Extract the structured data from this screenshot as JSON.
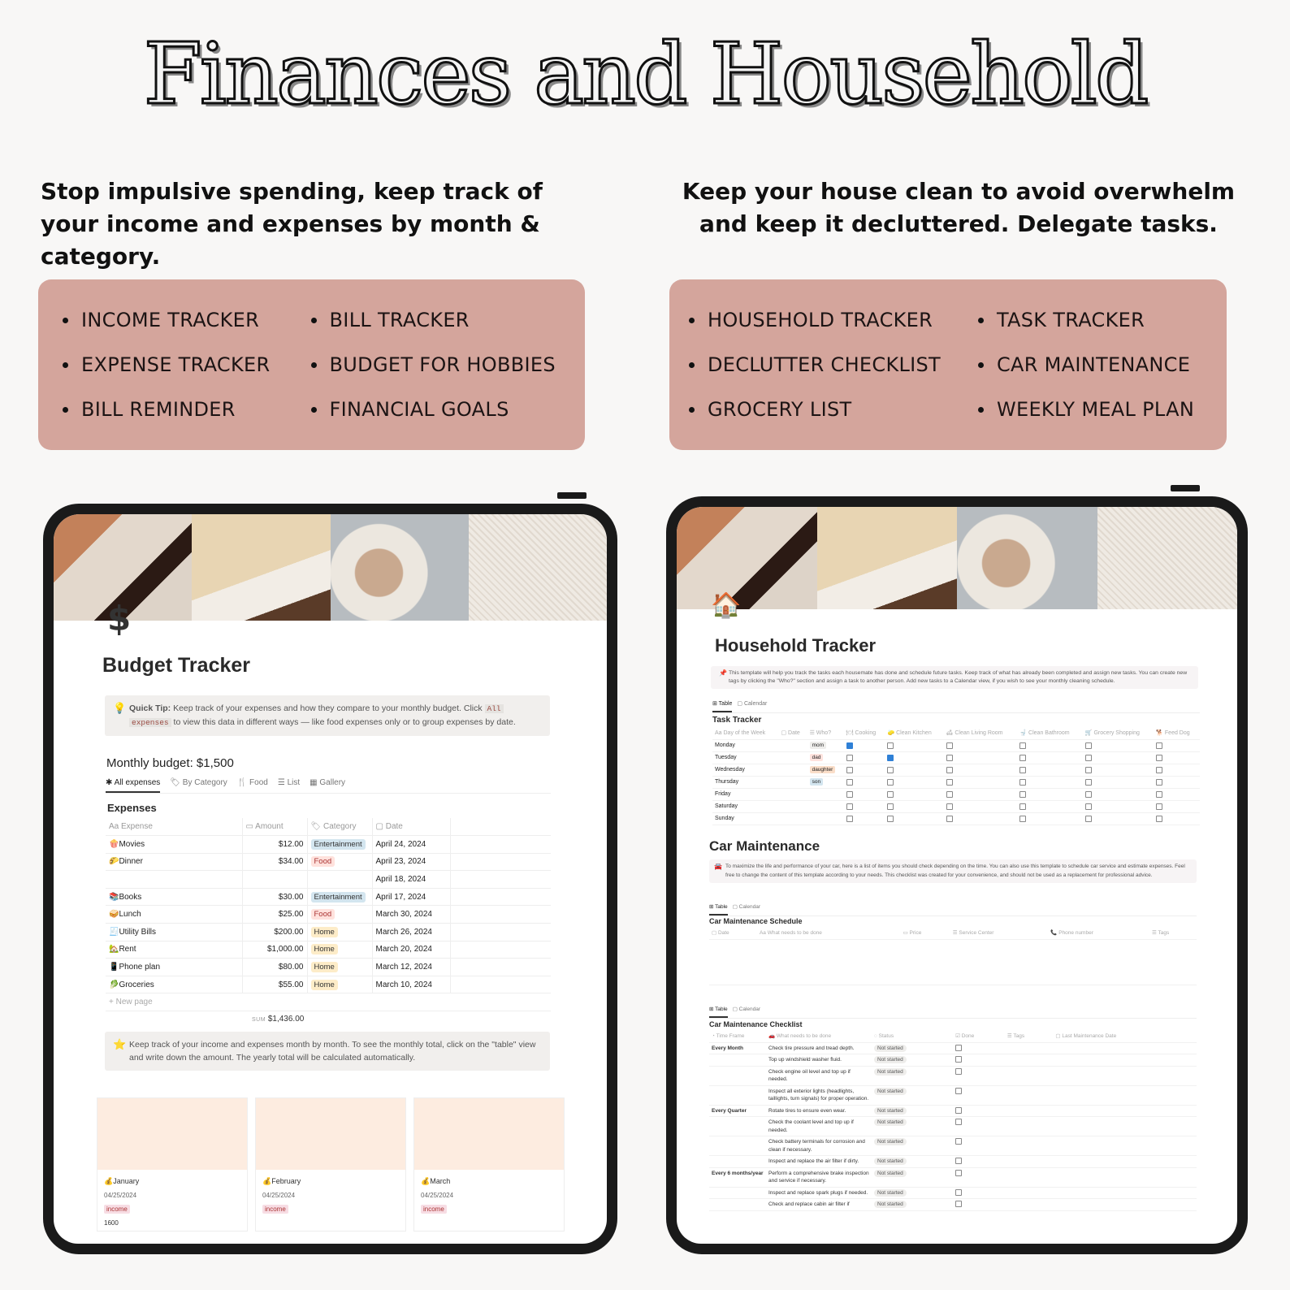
{
  "title": "Finances and Household",
  "left": {
    "subtitle": "Stop impulsive spending, keep track of your income and expenses by month & category.",
    "features": [
      "INCOME TRACKER",
      "BILL TRACKER",
      "EXPENSE TRACKER",
      "BUDGET FOR HOBBIES",
      "BILL REMINDER",
      "FINANCIAL GOALS"
    ],
    "page_icon": "$",
    "page_title": "Budget Tracker",
    "tip": {
      "icon": "💡",
      "bold": "Quick Tip:",
      "text1": " Keep track of your expenses and how they compare to your monthly budget. Click ",
      "code1": "All",
      "code2": "expenses",
      "text2": " to view this data in different ways — like food expenses only or to group expenses by date."
    },
    "monthly_budget": "Monthly budget: $1,500",
    "tabs": [
      "✱ All expenses",
      "🏷 By Category",
      "🍴 Food",
      "☰ List",
      "▦ Gallery"
    ],
    "table_title": "Expenses",
    "columns": [
      "Aa Expense",
      "▭ Amount",
      "🏷 Category",
      "▢ Date"
    ],
    "rows": [
      {
        "icon": "🍿",
        "name": "Movies",
        "amount": "$12.00",
        "category": "Entertainment",
        "date": "April 24, 2024"
      },
      {
        "icon": "🌮",
        "name": "Dinner",
        "amount": "$34.00",
        "category": "Food",
        "date": "April 23, 2024"
      },
      {
        "icon": "",
        "name": "",
        "amount": "",
        "category": "",
        "date": "April 18, 2024"
      },
      {
        "icon": "📚",
        "name": "Books",
        "amount": "$30.00",
        "category": "Entertainment",
        "date": "April 17, 2024"
      },
      {
        "icon": "🥪",
        "name": "Lunch",
        "amount": "$25.00",
        "category": "Food",
        "date": "March 30, 2024"
      },
      {
        "icon": "🧾",
        "name": "Utility Bills",
        "amount": "$200.00",
        "category": "Home",
        "date": "March 26, 2024"
      },
      {
        "icon": "🏡",
        "name": "Rent",
        "amount": "$1,000.00",
        "category": "Home",
        "date": "March 20, 2024"
      },
      {
        "icon": "📱",
        "name": "Phone plan",
        "amount": "$80.00",
        "category": "Home",
        "date": "March 12, 2024"
      },
      {
        "icon": "🥬",
        "name": "Groceries",
        "amount": "$55.00",
        "category": "Home",
        "date": "March 10, 2024"
      }
    ],
    "category_colors": {
      "Entertainment": "#d3e5ef",
      "Food": "#ffe2dd",
      "Home": "#fdecc8"
    },
    "new_page": "+ New page",
    "sum_label": "SUM",
    "sum_value": "$1,436.00",
    "note": {
      "icon": "⭐",
      "text": "Keep track of your income and expenses month by month. To see the monthly total, click on the \"table\" view and write down the amount. The yearly total will be calculated automatically."
    },
    "cards": [
      {
        "icon": "💰",
        "name": "January",
        "date": "04/25/2024",
        "tag": "income",
        "value": "1600"
      },
      {
        "icon": "💰",
        "name": "February",
        "date": "04/25/2024",
        "tag": "income",
        "value": ""
      },
      {
        "icon": "💰",
        "name": "March",
        "date": "04/25/2024",
        "tag": "income",
        "value": ""
      }
    ]
  },
  "right": {
    "subtitle": "Keep your house clean to avoid overwhelm and keep it decluttered. Delegate tasks.",
    "features": [
      "HOUSEHOLD TRACKER",
      "TASK TRACKER",
      "DECLUTTER CHECKLIST",
      "CAR MAINTENANCE",
      "GROCERY LIST",
      "WEEKLY MEAL PLAN"
    ],
    "page_icon": "🏠",
    "page_title": "Household Tracker",
    "intro": {
      "icon": "📌",
      "text": "This template will help you track the tasks each housemate has done and schedule future tasks. Keep track of what has already been completed and assign new tasks. You can create new tags by clicking the \"Who?\" section and assign a task to another person. Add new tasks to a Calendar view, if you wish to see your monthly cleaning schedule."
    },
    "view_tabs": [
      "⊞ Table",
      "▢ Calendar"
    ],
    "task_title": "Task Tracker",
    "task_columns": [
      "Aa Day of the Week",
      "▢ Date",
      "☰ Who?",
      "🍽 Cooking",
      "🧽 Clean Kitchen",
      "🛋 Clean Living Room",
      "🚽 Clean Bathroom",
      "🛒 Grocery Shopping",
      "🐕 Feed Dog"
    ],
    "task_rows": [
      {
        "day": "Monday",
        "who": "mom",
        "who_color": "#eeedeb",
        "checks": [
          true,
          false,
          false,
          false,
          false,
          false
        ]
      },
      {
        "day": "Tuesday",
        "who": "dad",
        "who_color": "#ffe2dd",
        "checks": [
          false,
          true,
          false,
          false,
          false,
          false
        ]
      },
      {
        "day": "Wednesday",
        "who": "daughter",
        "who_color": "#fadec9",
        "checks": [
          false,
          false,
          false,
          false,
          false,
          false
        ]
      },
      {
        "day": "Thursday",
        "who": "son",
        "who_color": "#d3e5ef",
        "checks": [
          false,
          false,
          false,
          false,
          false,
          false
        ]
      },
      {
        "day": "Friday",
        "who": "",
        "who_color": "",
        "checks": [
          false,
          false,
          false,
          false,
          false,
          false
        ]
      },
      {
        "day": "Saturday",
        "who": "",
        "who_color": "",
        "checks": [
          false,
          false,
          false,
          false,
          false,
          false
        ]
      },
      {
        "day": "Sunday",
        "who": "",
        "who_color": "",
        "checks": [
          false,
          false,
          false,
          false,
          false,
          false
        ]
      }
    ],
    "car_title": "Car Maintenance",
    "car_intro": {
      "icon": "🚘",
      "text": "To maximize the life and performance of your car, here is a list of items you should check depending on the time. You can also use this template to schedule car service and estimate expenses. Feel free to change the content of this template according to your needs. This checklist was created for your convenience, and should not be used as a replacement for professional advice."
    },
    "schedule_title": "Car Maintenance Schedule",
    "schedule_columns": [
      "▢ Date",
      "Aa What needs to be done",
      "▭ Price",
      "☰ Service Center",
      "📞 Phone number",
      "☰ Tags"
    ],
    "checklist_title": "Car Maintenance Checklist",
    "checklist_columns": [
      "◔ Time Frame",
      "🚗 What needs to be done",
      "◌ Status",
      "☑ Done",
      "☰ Tags",
      "▢ Last Maintenance Date"
    ],
    "checklist_rows": [
      {
        "frame": "Every Month",
        "task": "Check tire pressure and tread depth.",
        "status": "Not started"
      },
      {
        "frame": "",
        "task": "Top up windshield washer fluid.",
        "status": "Not started"
      },
      {
        "frame": "",
        "task": "Check engine oil level and top up if needed.",
        "status": "Not started"
      },
      {
        "frame": "",
        "task": "Inspect all exterior lights (headlights, taillights, turn signals) for proper operation.",
        "status": "Not started"
      },
      {
        "frame": "Every Quarter",
        "task": "Rotate tires to ensure even wear.",
        "status": "Not started"
      },
      {
        "frame": "",
        "task": "Check the coolant level and top up if needed.",
        "status": "Not started"
      },
      {
        "frame": "",
        "task": "Check battery terminals for corrosion and clean if necessary.",
        "status": "Not started"
      },
      {
        "frame": "",
        "task": "Inspect and replace the air filter if dirty.",
        "status": "Not started"
      },
      {
        "frame": "Every 6 months/year",
        "task": "Perform a comprehensive brake inspection and service if necessary.",
        "status": "Not started"
      },
      {
        "frame": "",
        "task": "Inspect and replace spark plugs if needed.",
        "status": "Not started"
      },
      {
        "frame": "",
        "task": "Check and replace cabin air filter if",
        "status": "Not started"
      }
    ]
  }
}
